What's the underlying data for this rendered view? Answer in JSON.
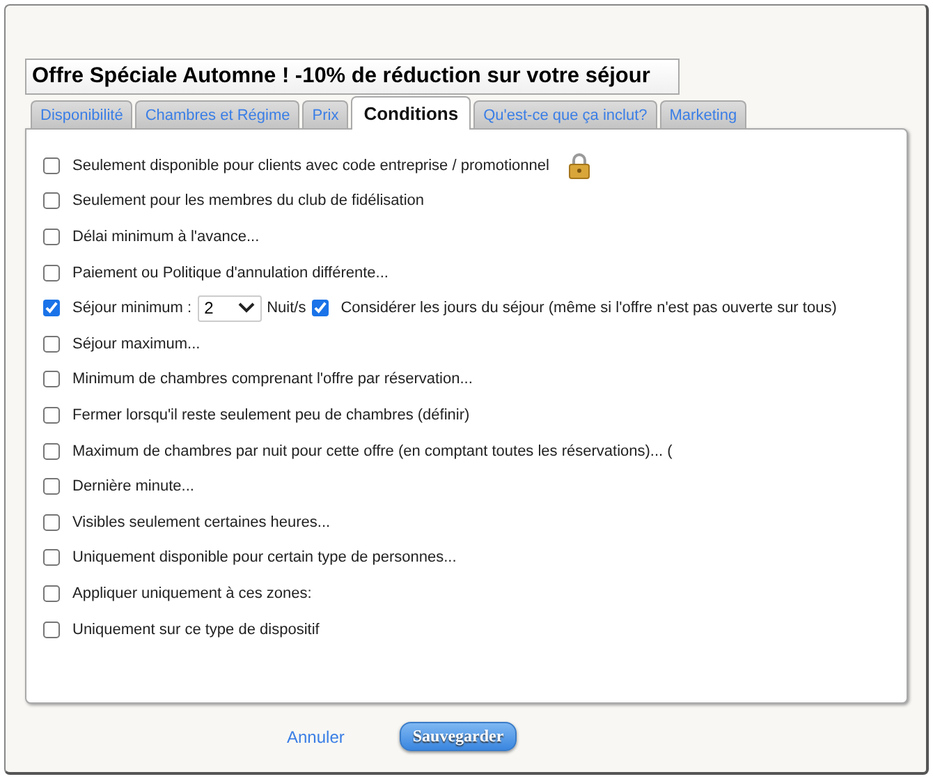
{
  "title_field": {
    "value": "Offre Spéciale Automne ! -10% de réduction sur votre séjour"
  },
  "tabs": [
    {
      "label": "Disponibilité",
      "selected": false
    },
    {
      "label": "Chambres et Régime",
      "selected": false
    },
    {
      "label": "Prix",
      "selected": false
    },
    {
      "label": "Conditions",
      "selected": true
    },
    {
      "label": "Qu'est-ce que ça inclut?",
      "selected": false
    },
    {
      "label": "Marketing",
      "selected": false
    }
  ],
  "conditions": [
    {
      "kind": "locked",
      "label": "Seulement disponible pour clients avec code entreprise / promotionnel",
      "checked": false
    },
    {
      "kind": "checkbox",
      "label": "Seulement pour les membres du club de fidélisation",
      "checked": false
    },
    {
      "kind": "checkbox",
      "label": "Délai minimum à l'avance...",
      "checked": false
    },
    {
      "kind": "checkbox",
      "label": "Paiement ou Politique d'annulation différente...",
      "checked": false
    },
    {
      "kind": "stay",
      "label": "Séjour minimum :",
      "checked": true,
      "nights": "2",
      "unit": "Nuit/s",
      "consider_checked": true,
      "consider_label": "Considérer les jours du séjour (même si l'offre n'est pas ouverte sur tous)"
    },
    {
      "kind": "checkbox",
      "label": "Séjour maximum...",
      "checked": false
    },
    {
      "kind": "checkbox",
      "label": "Minimum de chambres comprenant l'offre par réservation...",
      "checked": false
    },
    {
      "kind": "checkbox",
      "label": "Fermer lorsqu'il reste seulement peu de chambres (définir)",
      "checked": false
    },
    {
      "kind": "checkbox",
      "label": "Maximum de chambres par nuit pour cette offre (en comptant toutes les réservations)... (",
      "checked": false
    },
    {
      "kind": "checkbox",
      "label": "Dernière minute...",
      "checked": false
    },
    {
      "kind": "checkbox",
      "label": "Visibles seulement certaines heures...",
      "checked": false
    },
    {
      "kind": "checkbox",
      "label": "Uniquement disponible pour certain type de personnes...",
      "checked": false
    },
    {
      "kind": "checkbox",
      "label": "Appliquer uniquement à ces zones:",
      "checked": false
    },
    {
      "kind": "checkbox",
      "label": "Uniquement sur ce type de dispositif",
      "checked": false
    }
  ],
  "footer": {
    "cancel": "Annuler",
    "save": "Sauvegarder"
  }
}
